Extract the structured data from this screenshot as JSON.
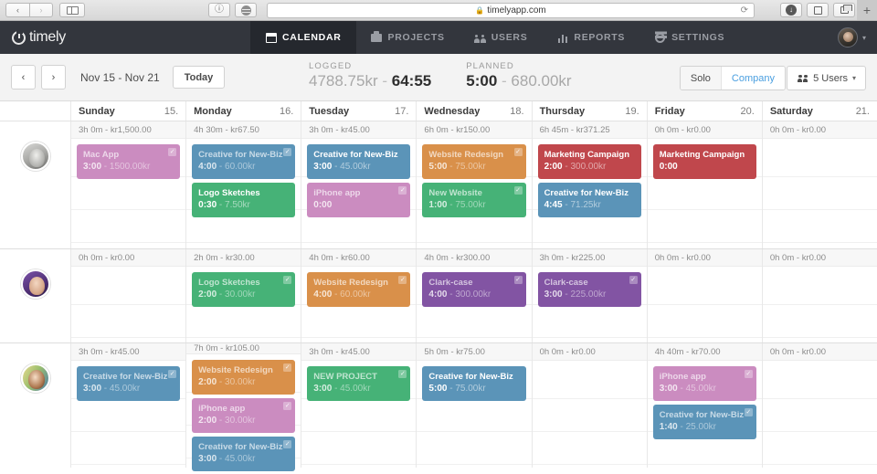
{
  "browser": {
    "back_icon": "chevron-left-icon",
    "forward_icon": "chevron-right-icon",
    "sidebar_icon": "sidebar-toggle-icon",
    "info_icon": "info-icon",
    "reader_icon": "reader-icon",
    "url": "timelyapp.com",
    "lock_icon": "lock-icon",
    "reload_icon": "reload-icon",
    "download_icon": "download-icon",
    "share_icon": "share-icon",
    "tabs_icon": "tab-overview-icon",
    "new_tab_label": "+"
  },
  "app": {
    "brand": "timely",
    "nav": [
      {
        "label": "CALENDAR",
        "icon": "calendar-icon",
        "active": true
      },
      {
        "label": "PROJECTS",
        "icon": "briefcase-icon",
        "active": false
      },
      {
        "label": "USERS",
        "icon": "users-icon",
        "active": false
      },
      {
        "label": "REPORTS",
        "icon": "bar-chart-icon",
        "active": false
      },
      {
        "label": "SETTINGS",
        "icon": "gear-icon",
        "active": false
      }
    ],
    "account_caret": "▾"
  },
  "toolbar": {
    "prev_icon": "‹",
    "next_icon": "›",
    "date_range": "Nov 15 - Nov 21",
    "today_label": "Today",
    "logged_label": "LOGGED",
    "logged_amount": "4788.75kr",
    "logged_separator": "-",
    "logged_time": "64:55",
    "planned_label": "PLANNED",
    "planned_time": "5:00",
    "planned_separator": "-",
    "planned_amount": "680.00kr",
    "solo_label": "Solo",
    "company_label": "Company",
    "users_icon": "users-icon",
    "users_label": "5 Users",
    "users_caret": "▾",
    "accent_color": "#4a9fe0"
  },
  "calendar": {
    "days": [
      {
        "name": "Sunday",
        "num": "15."
      },
      {
        "name": "Monday",
        "num": "16."
      },
      {
        "name": "Tuesday",
        "num": "17."
      },
      {
        "name": "Wednesday",
        "num": "18."
      },
      {
        "name": "Thursday",
        "num": "19."
      },
      {
        "name": "Friday",
        "num": "20."
      },
      {
        "name": "Saturday",
        "num": "21."
      }
    ],
    "colors": {
      "pink": "#cb8cc0",
      "blue": "#5b94b8",
      "green": "#46b277",
      "orange": "#d9904a",
      "red": "#c0474c",
      "purple": "#8254a3"
    },
    "rows": [
      {
        "avatar": "avatar-user-1",
        "cells": [
          {
            "total": "3h 0m - kr1,500.00",
            "entries": [
              {
                "title": "Mac App",
                "time": "3:00",
                "sep": " - ",
                "amount": "1500.00kr",
                "color": "#cb8cc0",
                "state": "logged"
              }
            ]
          },
          {
            "total": "4h 30m - kr67.50",
            "entries": [
              {
                "title": "Creative for New-Biz",
                "time": "4:00",
                "sep": " - ",
                "amount": "60.00kr",
                "color": "#5b94b8",
                "state": "logged"
              },
              {
                "title": "Logo Sketches",
                "time": "0:30",
                "sep": " - ",
                "amount": "7.50kr",
                "color": "#46b277",
                "state": "active"
              }
            ]
          },
          {
            "total": "3h 0m - kr45.00",
            "entries": [
              {
                "title": "Creative for New-Biz",
                "time": "3:00",
                "sep": " - ",
                "amount": "45.00kr",
                "color": "#5b94b8",
                "state": "active"
              },
              {
                "title": "iPhone app",
                "time": "0:00",
                "sep": "",
                "amount": "",
                "color": "#cb8cc0",
                "state": "logged"
              }
            ]
          },
          {
            "total": "6h 0m - kr150.00",
            "entries": [
              {
                "title": "Website Redesign",
                "time": "5:00",
                "sep": " - ",
                "amount": "75.00kr",
                "color": "#d9904a",
                "state": "logged"
              },
              {
                "title": "New Website",
                "time": "1:00",
                "sep": " - ",
                "amount": "75.00kr",
                "color": "#46b277",
                "state": "logged"
              }
            ]
          },
          {
            "total": "6h 45m - kr371.25",
            "entries": [
              {
                "title": "Marketing Campaign",
                "time": "2:00",
                "sep": " - ",
                "amount": "300.00kr",
                "color": "#c0474c",
                "state": "active"
              },
              {
                "title": "Creative for New-Biz",
                "time": "4:45",
                "sep": " - ",
                "amount": "71.25kr",
                "color": "#5b94b8",
                "state": "active"
              }
            ]
          },
          {
            "total": "0h 0m - kr0.00",
            "entries": [
              {
                "title": "Marketing Campaign",
                "time": "0:00",
                "sep": "",
                "amount": "",
                "color": "#c0474c",
                "state": "active"
              }
            ]
          },
          {
            "total": "0h 0m - kr0.00",
            "entries": []
          }
        ]
      },
      {
        "avatar": "avatar-user-2",
        "cells": [
          {
            "total": "0h 0m - kr0.00",
            "entries": []
          },
          {
            "total": "2h 0m - kr30.00",
            "entries": [
              {
                "title": "Logo Sketches",
                "time": "2:00",
                "sep": " - ",
                "amount": "30.00kr",
                "color": "#46b277",
                "state": "logged"
              }
            ]
          },
          {
            "total": "4h 0m - kr60.00",
            "entries": [
              {
                "title": "Website Redesign",
                "time": "4:00",
                "sep": " - ",
                "amount": "60.00kr",
                "color": "#d9904a",
                "state": "logged"
              }
            ]
          },
          {
            "total": "4h 0m - kr300.00",
            "entries": [
              {
                "title": "Clark-case",
                "time": "4:00",
                "sep": " - ",
                "amount": "300.00kr",
                "color": "#8254a3",
                "state": "logged"
              }
            ]
          },
          {
            "total": "3h 0m - kr225.00",
            "entries": [
              {
                "title": "Clark-case",
                "time": "3:00",
                "sep": " - ",
                "amount": "225.00kr",
                "color": "#8254a3",
                "state": "logged"
              }
            ]
          },
          {
            "total": "0h 0m - kr0.00",
            "entries": []
          },
          {
            "total": "0h 0m - kr0.00",
            "entries": []
          }
        ]
      },
      {
        "avatar": "avatar-user-3",
        "cells": [
          {
            "total": "3h 0m - kr45.00",
            "entries": [
              {
                "title": "Creative for New-Biz",
                "time": "3:00",
                "sep": " - ",
                "amount": "45.00kr",
                "color": "#5b94b8",
                "state": "logged"
              }
            ]
          },
          {
            "total": "7h 0m - kr105.00",
            "entries": [
              {
                "title": "Website Redesign",
                "time": "2:00",
                "sep": " - ",
                "amount": "30.00kr",
                "color": "#d9904a",
                "state": "logged"
              },
              {
                "title": "iPhone app",
                "time": "2:00",
                "sep": " - ",
                "amount": "30.00kr",
                "color": "#cb8cc0",
                "state": "logged"
              },
              {
                "title": "Creative for New-Biz",
                "time": "3:00",
                "sep": " - ",
                "amount": "45.00kr",
                "color": "#5b94b8",
                "state": "logged"
              }
            ]
          },
          {
            "total": "3h 0m - kr45.00",
            "entries": [
              {
                "title": "NEW PROJECT",
                "time": "3:00",
                "sep": " - ",
                "amount": "45.00kr",
                "color": "#46b277",
                "state": "logged"
              }
            ]
          },
          {
            "total": "5h 0m - kr75.00",
            "entries": [
              {
                "title": "Creative for New-Biz",
                "time": "5:00",
                "sep": " - ",
                "amount": "75.00kr",
                "color": "#5b94b8",
                "state": "active"
              }
            ]
          },
          {
            "total": "0h 0m - kr0.00",
            "entries": []
          },
          {
            "total": "4h 40m - kr70.00",
            "entries": [
              {
                "title": "iPhone app",
                "time": "3:00",
                "sep": " - ",
                "amount": "45.00kr",
                "color": "#cb8cc0",
                "state": "logged"
              },
              {
                "title": "Creative for New-Biz",
                "time": "1:40",
                "sep": " - ",
                "amount": "25.00kr",
                "color": "#5b94b8",
                "state": "logged"
              }
            ]
          },
          {
            "total": "0h 0m - kr0.00",
            "entries": []
          }
        ]
      }
    ]
  }
}
